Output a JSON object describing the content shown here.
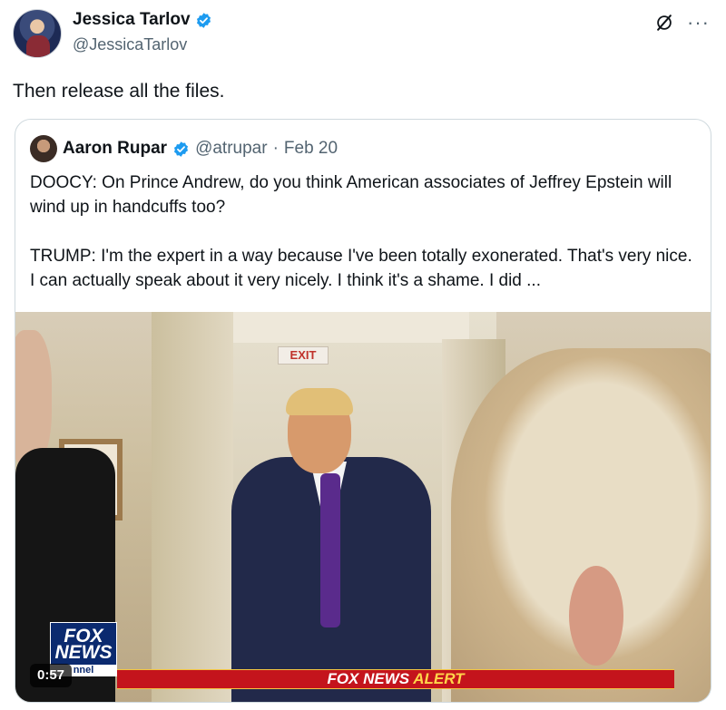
{
  "author": {
    "display_name": "Jessica Tarlov",
    "handle": "@JessicaTarlov",
    "verified_icon": "verified-badge-icon"
  },
  "header_actions": {
    "grok_icon": "grok-icon",
    "more_icon": "more-options-icon",
    "more_glyph": "···"
  },
  "tweet": {
    "text": "Then release all the files."
  },
  "quoted_tweet": {
    "display_name": "Aaron Rupar",
    "handle": "@atrupar",
    "separator": "·",
    "date": "Feb 20",
    "paragraph_1": "DOOCY: On Prince Andrew, do you think American associates of Jeffrey Epstein will wind up in handcuffs too?",
    "paragraph_2": "TRUMP: I'm the expert in a way because I've been totally exonerated. That's very nice. I can actually speak about it very nicely. I think it's a shame. I did ...",
    "video": {
      "duration": "0:57",
      "exit_sign": "EXIT",
      "fox_logo_line1": "FOX",
      "fox_logo_line2": "NEWS",
      "fox_logo_line3": "nnel",
      "alert_prefix": "FOX NEWS",
      "alert_word": "ALERT"
    }
  },
  "colors": {
    "verified_blue": "#1d9bf0",
    "secondary_text": "#536471",
    "fox_red": "#c4141c",
    "fox_yellow": "#ffd54a"
  }
}
